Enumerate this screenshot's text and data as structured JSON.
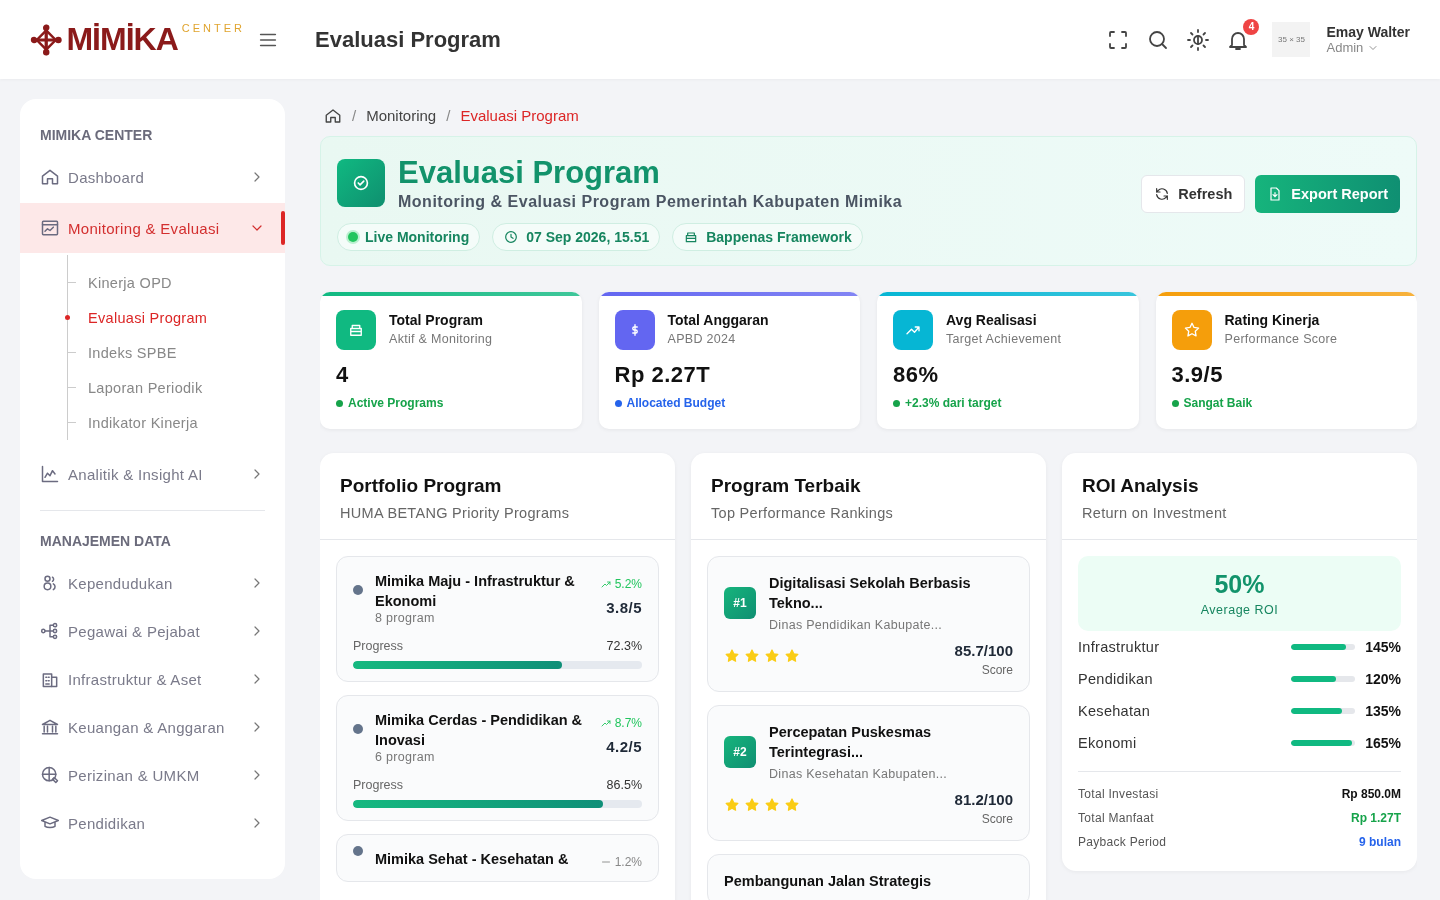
{
  "header": {
    "logo_text": "MİMİKA",
    "logo_sub": "CENTER",
    "page_title": "Evaluasi Program",
    "notification_count": "4",
    "avatar_text": "35 × 35",
    "user_name": "Emay Walter",
    "user_role": "Admin"
  },
  "sidebar": {
    "sections": [
      {
        "title": "MIMIKA CENTER",
        "items": [
          {
            "label": "Dashboard",
            "selected": false,
            "expanded": false
          },
          {
            "label": "Monitoring & Evaluasi",
            "selected": true,
            "expanded": true,
            "children": [
              {
                "label": "Kinerja OPD",
                "selected": false
              },
              {
                "label": "Evaluasi Program",
                "selected": true
              },
              {
                "label": "Indeks SPBE",
                "selected": false
              },
              {
                "label": "Laporan Periodik",
                "selected": false
              },
              {
                "label": "Indikator Kinerja",
                "selected": false
              }
            ]
          },
          {
            "label": "Analitik & Insight AI",
            "selected": false,
            "expanded": false
          }
        ]
      },
      {
        "title": "MANAJEMEN DATA",
        "items": [
          {
            "label": "Kependudukan",
            "selected": false,
            "expanded": false
          },
          {
            "label": "Pegawai & Pejabat",
            "selected": false,
            "expanded": false
          },
          {
            "label": "Infrastruktur & Aset",
            "selected": false,
            "expanded": false
          },
          {
            "label": "Keuangan & Anggaran",
            "selected": false,
            "expanded": false
          },
          {
            "label": "Perizinan & UMKM",
            "selected": false,
            "expanded": false
          },
          {
            "label": "Pendidikan",
            "selected": false,
            "expanded": false
          }
        ]
      }
    ]
  },
  "breadcrumb": [
    {
      "separator": "/",
      "label": "Monitoring",
      "selected": false
    },
    {
      "separator": "/",
      "label": "Evaluasi Program",
      "selected": true
    }
  ],
  "hero": {
    "title": "Evaluasi Program",
    "subtitle": "Monitoring & Evaluasi Program Pemerintah Kabupaten Mimika",
    "pills": [
      {
        "kind": "live",
        "label": "Live Monitoring"
      },
      {
        "kind": "time",
        "label": "07 Sep 2026, 15.51"
      },
      {
        "kind": "framework",
        "label": "Bappenas Framework"
      }
    ],
    "buttons": [
      {
        "kind": "secondary",
        "label": "Refresh"
      },
      {
        "kind": "primary",
        "label": "Export Report"
      }
    ]
  },
  "stats": [
    {
      "title": "Total Program",
      "subtitle": "Aktif & Monitoring",
      "value": "4",
      "note": {
        "text": "Active Programs",
        "color": "#16a34a"
      },
      "color": "#10b981"
    },
    {
      "title": "Total Anggaran",
      "subtitle": "APBD 2024",
      "value": "Rp 2.27T",
      "note": {
        "text": "Allocated Budget",
        "color": "#2563eb"
      },
      "color": "#6366f1"
    },
    {
      "title": "Avg Realisasi",
      "subtitle": "Target Achievement",
      "value": "86%",
      "note": {
        "text": "+2.3% dari target",
        "color": "#16a34a"
      },
      "color": "#06b6d4"
    },
    {
      "title": "Rating Kinerja",
      "subtitle": "Performance Score",
      "value": "3.9/5",
      "note": {
        "text": "Sangat Baik",
        "color": "#16a34a"
      },
      "color": "#f59e0b"
    }
  ],
  "portfolio": {
    "title": "Portfolio Program",
    "subtitle": "HUMA BETANG Priority Programs",
    "items": [
      {
        "name": "Mimika Maju - Infrastruktur & Ekonomi",
        "count": "8 program",
        "trend": {
          "kind": "up",
          "value": "5.2%"
        },
        "rating": "3.8/5",
        "progress_label": "Progress",
        "progress_value": "72.3%",
        "level": 0.723
      },
      {
        "name": "Mimika Cerdas - Pendidikan & Inovasi",
        "count": "6 program",
        "trend": {
          "kind": "up",
          "value": "8.7%"
        },
        "rating": "4.2/5",
        "progress_label": "Progress",
        "progress_value": "86.5%",
        "level": 0.865
      },
      {
        "name": "Mimika Sehat - Kesehatan &",
        "trend": {
          "kind": "flat",
          "value": "1.2%"
        }
      }
    ]
  },
  "ranking": {
    "title": "Program Terbaik",
    "subtitle": "Top Performance Rankings",
    "items": [
      {
        "rank": "#1",
        "name": "Digitalisasi Sekolah Berbasis Tekno...",
        "org": "Dinas Pendidikan Kabupate...",
        "stars": 4,
        "score": "85.7/100",
        "score_label": "Score"
      },
      {
        "rank": "#2",
        "name": "Percepatan Puskesmas Terintegrasi...",
        "org": "Dinas Kesehatan Kabupaten...",
        "stars": 4,
        "score": "81.2/100",
        "score_label": "Score"
      },
      {
        "name": "Pembangunan Jalan Strategis"
      }
    ]
  },
  "roi": {
    "title": "ROI Analysis",
    "subtitle": "Return on Investment",
    "average": "50%",
    "average_label": "Average ROI",
    "sectors": [
      {
        "name": "Infrastruktur",
        "value": "145%",
        "level": 0.86
      },
      {
        "name": "Pendidikan",
        "value": "120%",
        "level": 0.71
      },
      {
        "name": "Kesehatan",
        "value": "135%",
        "level": 0.8
      },
      {
        "name": "Ekonomi",
        "value": "165%",
        "level": 0.95
      }
    ],
    "summary": [
      {
        "label": "Total Investasi",
        "value": "Rp 850.0M",
        "color": "#111111"
      },
      {
        "label": "Total Manfaat",
        "value": "Rp 1.27T",
        "color": "#16a34a"
      },
      {
        "label": "Payback Period",
        "value": "9 bulan",
        "color": "#2563eb"
      }
    ]
  }
}
